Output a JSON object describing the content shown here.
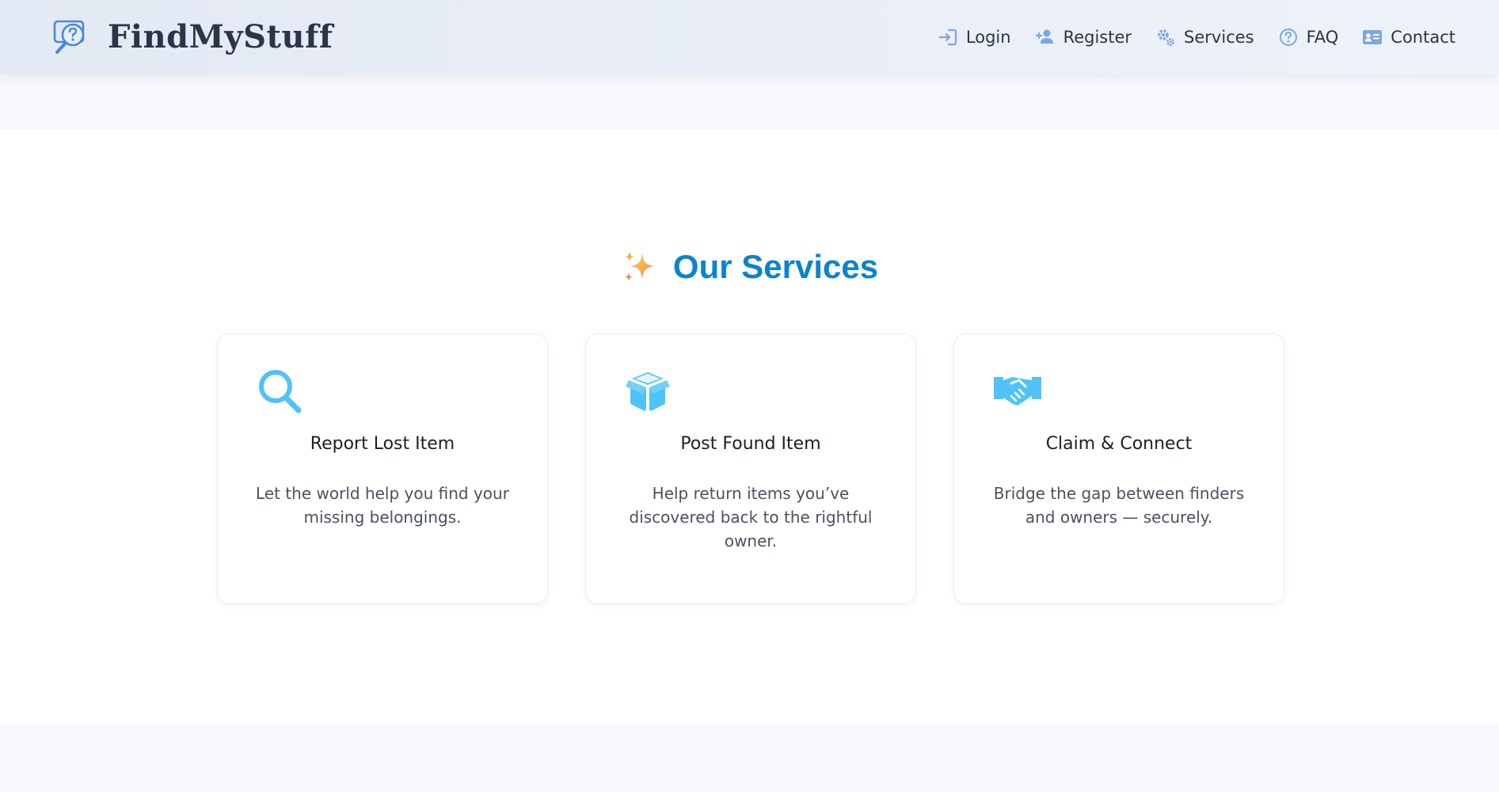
{
  "brand": {
    "name": "FindMyStuff",
    "icon": "search-question-icon"
  },
  "nav": {
    "items": [
      {
        "label": "Login",
        "icon": "login-icon"
      },
      {
        "label": "Register",
        "icon": "user-plus-icon"
      },
      {
        "label": "Services",
        "icon": "gears-icon"
      },
      {
        "label": "FAQ",
        "icon": "question-circle-icon"
      },
      {
        "label": "Contact",
        "icon": "contact-card-icon"
      }
    ]
  },
  "services": {
    "emoji": "✨",
    "title": "Our Services",
    "cards": [
      {
        "icon": "magnifier-icon",
        "title": "Report Lost Item",
        "description": "Let the world help you find your missing belongings."
      },
      {
        "icon": "box-icon",
        "title": "Post Found Item",
        "description": "Help return items you’ve discovered back to the rightful owner."
      },
      {
        "icon": "handshake-icon",
        "title": "Claim & Connect",
        "description": "Bridge the gap between finders and owners — securely."
      }
    ]
  },
  "colors": {
    "accent": "#0a84d0",
    "icon_blue": "#4fc3f7",
    "nav_icon": "#7aa6e6",
    "text_dark": "#2a3547"
  }
}
